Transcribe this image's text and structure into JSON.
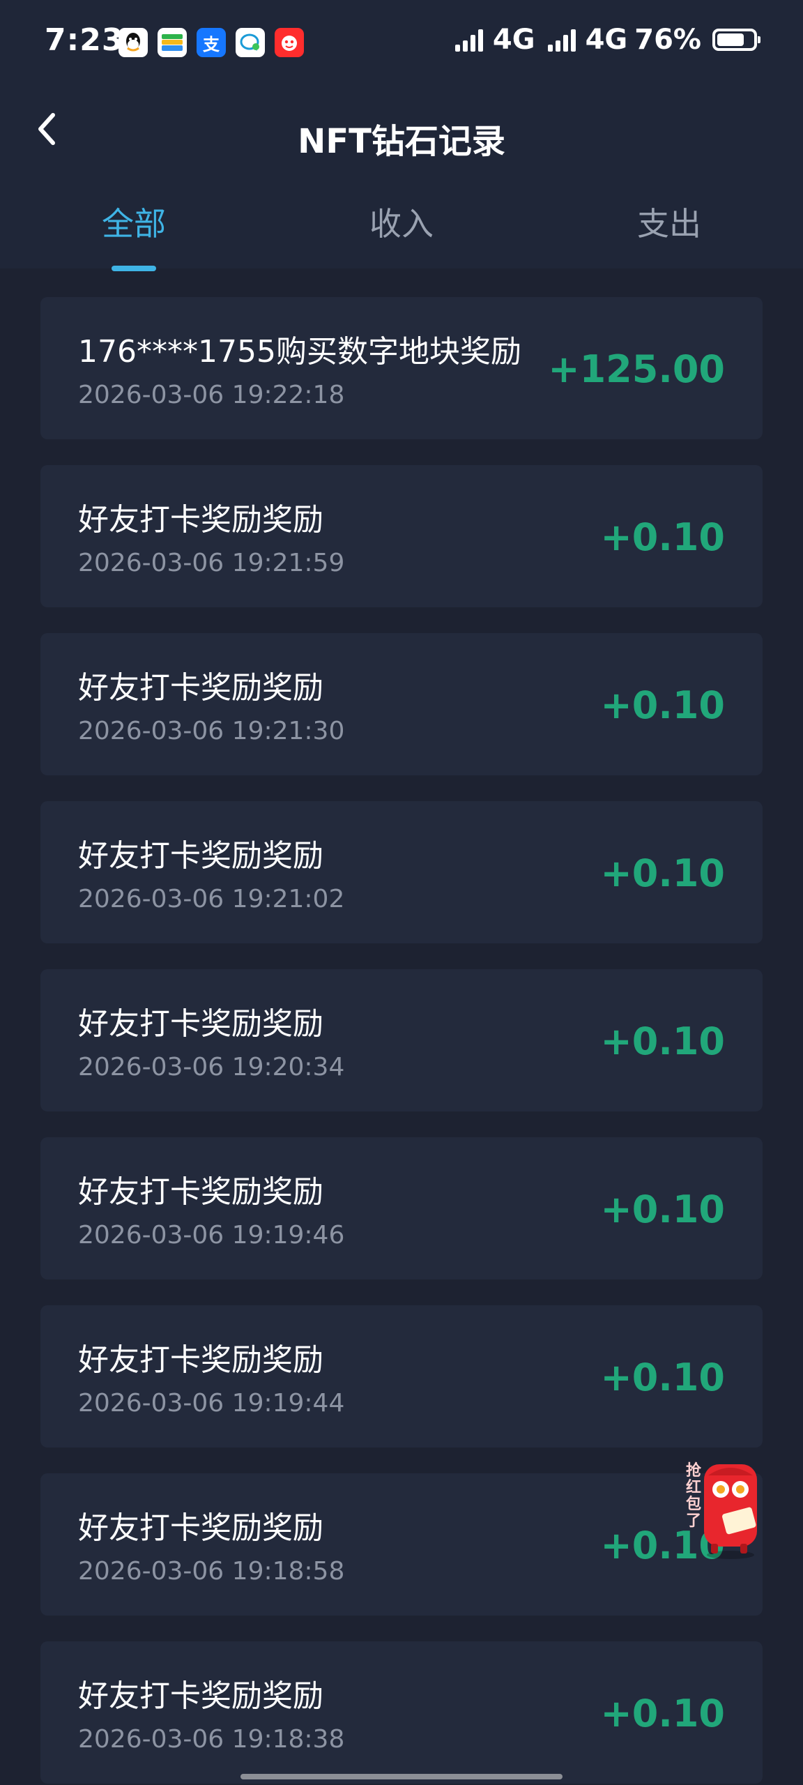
{
  "status_bar": {
    "time": "7:23",
    "network_1": "4G",
    "network_2": "4G",
    "battery": "76%",
    "battery_level": 0.76,
    "app_icons": [
      "qq-icon",
      "wallet-icon",
      "alipay-icon",
      "message-icon",
      "red-app-icon"
    ]
  },
  "header": {
    "title": "NFT钻石记录",
    "back_icon": "chevron-left-icon"
  },
  "tabs": [
    {
      "label": "全部",
      "active": true
    },
    {
      "label": "收入",
      "active": false
    },
    {
      "label": "支出",
      "active": false
    }
  ],
  "records": [
    {
      "title": "176****1755购买数字地块奖励",
      "time": "2026-03-06 19:22:18",
      "amount": "+125.00"
    },
    {
      "title": "好友打卡奖励奖励",
      "time": "2026-03-06 19:21:59",
      "amount": "+0.10"
    },
    {
      "title": "好友打卡奖励奖励",
      "time": "2026-03-06 19:21:30",
      "amount": "+0.10"
    },
    {
      "title": "好友打卡奖励奖励",
      "time": "2026-03-06 19:21:02",
      "amount": "+0.10"
    },
    {
      "title": "好友打卡奖励奖励",
      "time": "2026-03-06 19:20:34",
      "amount": "+0.10"
    },
    {
      "title": "好友打卡奖励奖励",
      "time": "2026-03-06 19:19:46",
      "amount": "+0.10"
    },
    {
      "title": "好友打卡奖励奖励",
      "time": "2026-03-06 19:19:44",
      "amount": "+0.10"
    },
    {
      "title": "好友打卡奖励奖励",
      "time": "2026-03-06 19:18:58",
      "amount": "+0.10"
    },
    {
      "title": "好友打卡奖励奖励",
      "time": "2026-03-06 19:18:38",
      "amount": "+0.10"
    }
  ],
  "float_widget": {
    "icon": "red-envelope-icon",
    "text": "抢红包了"
  },
  "colors": {
    "background": "#1d2231",
    "card": "#232a3c",
    "accent": "#3fb4e6",
    "amount_positive": "#21a77a"
  }
}
